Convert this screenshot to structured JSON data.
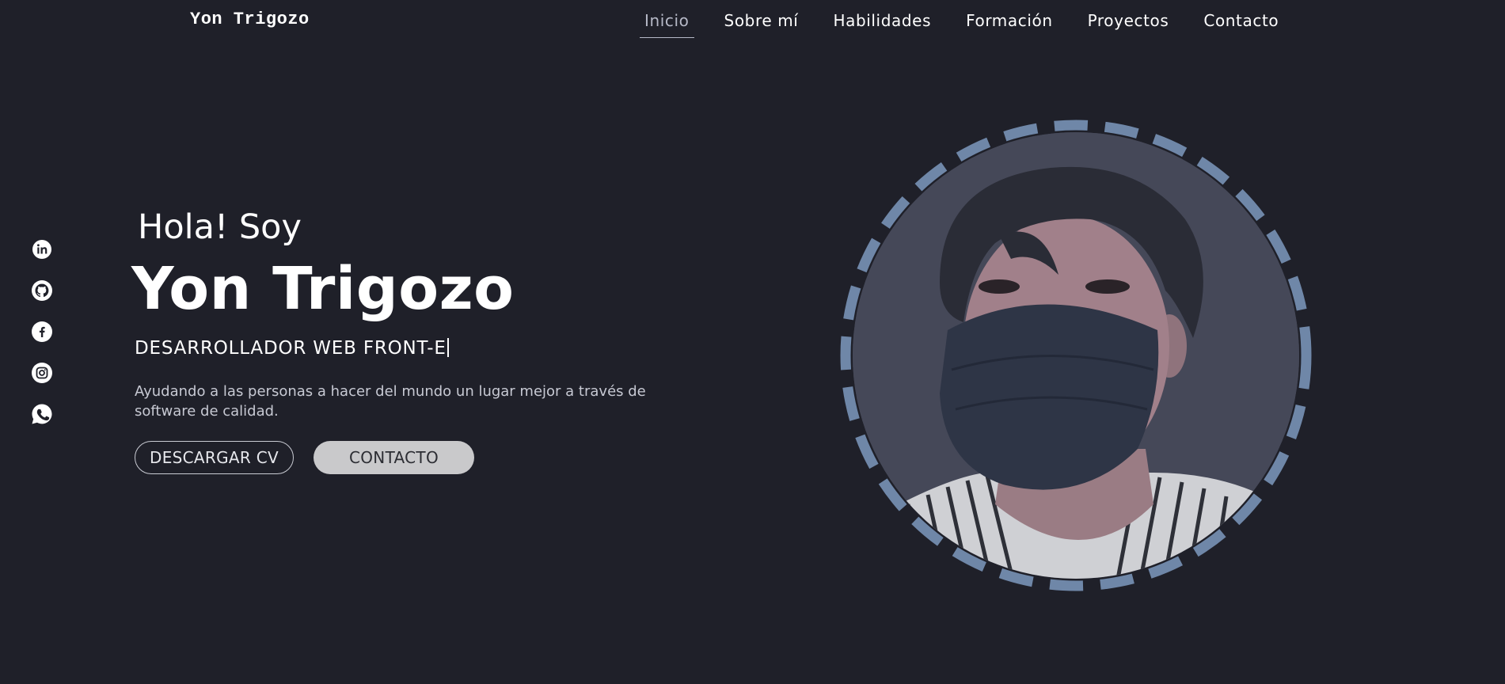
{
  "header": {
    "logo": "Yon Trigozo",
    "nav": [
      {
        "label": "Inicio",
        "active": true
      },
      {
        "label": "Sobre mí",
        "active": false
      },
      {
        "label": "Habilidades",
        "active": false
      },
      {
        "label": "Formación",
        "active": false
      },
      {
        "label": "Proyectos",
        "active": false
      },
      {
        "label": "Contacto",
        "active": false
      }
    ]
  },
  "social": [
    {
      "icon": "linkedin-icon"
    },
    {
      "icon": "github-icon"
    },
    {
      "icon": "facebook-icon"
    },
    {
      "icon": "instagram-icon"
    },
    {
      "icon": "whatsapp-icon"
    }
  ],
  "hero": {
    "greeting": "Hola! Soy",
    "name": "Yon Trigozo",
    "role": "DESARROLLADOR WEB FRONT-E",
    "tagline": "Ayudando a las personas a hacer del mundo un lugar mejor a través de software de calidad.",
    "cv_button": "DESCARGAR CV",
    "contact_button": "CONTACTO"
  },
  "colors": {
    "background": "#1f2029",
    "ring": "#6f87a8",
    "portrait_bg": "#454858",
    "nav_active": "#b6b9c7",
    "button_fill": "#c9c9cb"
  }
}
